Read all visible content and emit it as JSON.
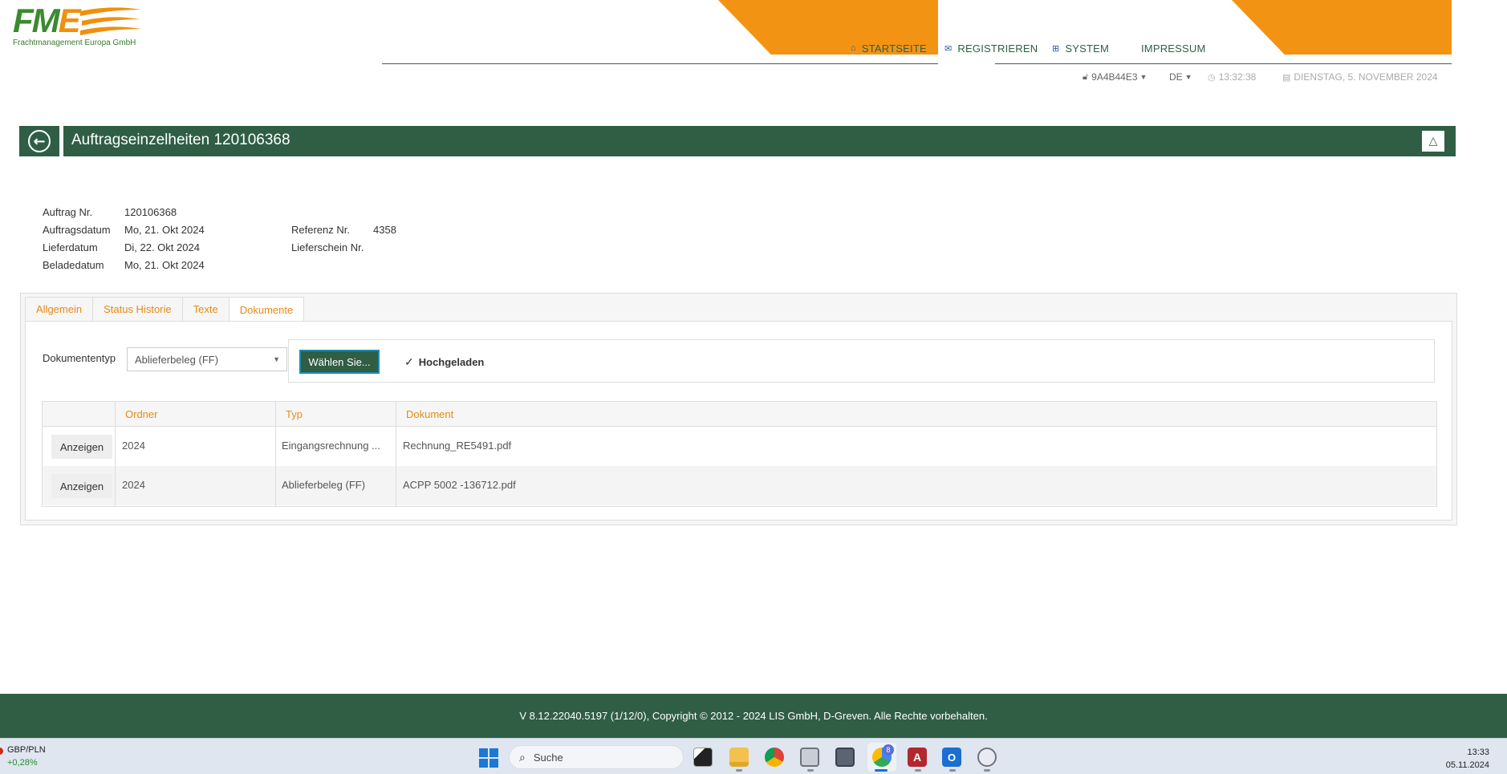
{
  "brand": {
    "logo_text": "FME",
    "subtitle": "Frachtmanagement Europa GmbH",
    "green": "#3a8a2e",
    "orange": "#f39314",
    "dark_green": "#2f5e44"
  },
  "nav": {
    "items": [
      {
        "label": "STARTSEITE",
        "icon": "home-icon"
      },
      {
        "label": "REGISTRIEREN",
        "icon": "envelope-icon"
      },
      {
        "label": "SYSTEM",
        "icon": "network-icon"
      },
      {
        "label": "IMPRESSUM",
        "icon": ""
      }
    ]
  },
  "infobar": {
    "user": "9A4B44E3",
    "language": "DE",
    "time": "13:32:38",
    "date": "DIENSTAG, 5. NOVEMBER 2024"
  },
  "page": {
    "title": "Auftragseinzelheiten 120106368"
  },
  "details": {
    "auftrag_nr_label": "Auftrag Nr.",
    "auftrag_nr": "120106368",
    "auftragsdatum_label": "Auftragsdatum",
    "auftragsdatum": "Mo, 21. Okt 2024",
    "lieferdatum_label": "Lieferdatum",
    "lieferdatum": "Di, 22. Okt 2024",
    "beladedatum_label": "Beladedatum",
    "beladedatum": "Mo, 21. Okt 2024",
    "referenz_label": "Referenz Nr.",
    "referenz": "4358",
    "lieferschein_label": "Lieferschein Nr.",
    "lieferschein": ""
  },
  "tabs": [
    "Allgemein",
    "Status Historie",
    "Texte",
    "Dokumente"
  ],
  "active_tab": "Dokumente",
  "documents": {
    "type_label": "Dokumententyp",
    "type_value": "Ablieferbeleg (FF)",
    "choose_label": "Wählen Sie...",
    "uploaded_label": "Hochgeladen",
    "columns": [
      "Ordner",
      "Typ",
      "Dokument"
    ],
    "show_label": "Anzeigen",
    "rows": [
      {
        "ordner": "2024",
        "typ": "Eingangsrechnung ...",
        "dokument": "Rechnung_RE5491.pdf"
      },
      {
        "ordner": "2024",
        "typ": "Ablieferbeleg (FF)",
        "dokument": "ACPP 5002 -136712.pdf"
      }
    ]
  },
  "footer": {
    "text": "V 8.12.22040.5197 (1/12/0), Copyright © 2012 - 2024 LIS GmbH, D-Greven. Alle Rechte vorbehalten."
  },
  "taskbar": {
    "ticker_symbol": "GBP/PLN",
    "ticker_change": "+0,28%",
    "search_placeholder": "Suche",
    "chrome_badge": "8",
    "clock_time": "13:33",
    "clock_date": "05.11.2024"
  }
}
